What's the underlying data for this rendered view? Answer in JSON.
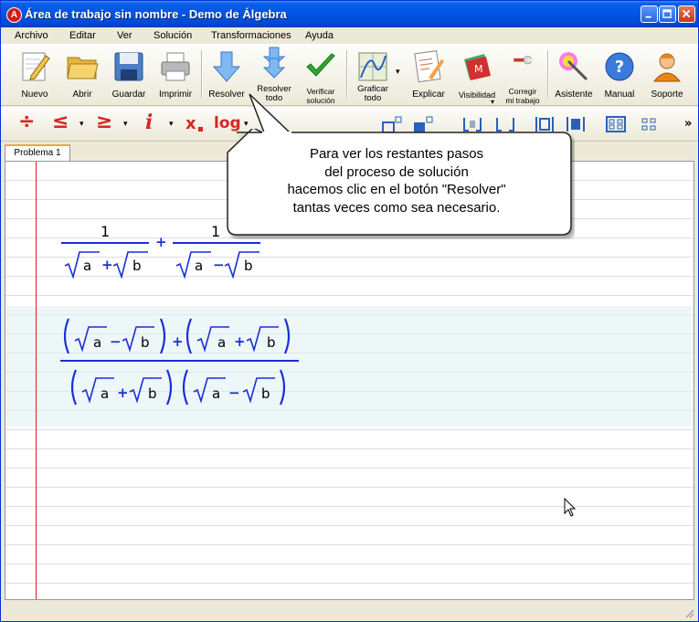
{
  "window": {
    "title": "Área de trabajo sin nombre - Demo de Álgebra",
    "app_icon_letter": "A"
  },
  "menu": [
    "Archivo",
    "Editar",
    "Ver",
    "Solución",
    "Transformaciones",
    "Ayuda"
  ],
  "toolbar": {
    "nuevo": "Nuevo",
    "abrir": "Abrir",
    "guardar": "Guardar",
    "imprimir": "Imprimir",
    "resolver": "Resolver",
    "resolver_todo_1": "Resolver",
    "resolver_todo_2": "todo",
    "verificar_1": "Verificar",
    "verificar_2": "solución",
    "graficar_1": "Graficar",
    "graficar_2": "todo",
    "explicar": "Explicar",
    "visibilidad": "Visibilidad",
    "corregir_1": "Corregir",
    "corregir_2": "mi trabajo",
    "asistente": "Asistente",
    "manual": "Manual",
    "soporte": "Soporte",
    "help_glyph": "?",
    "visibilidad_glyph": "M"
  },
  "math_toolbar": {
    "divide": "÷",
    "le": "≤",
    "ge": "≥",
    "imag": "i",
    "subscript": "x",
    "log": "log",
    "more": "»",
    "dropdown": "▾"
  },
  "tabs": [
    "Problema 1"
  ],
  "callout": {
    "lines": [
      "Para ver los restantes pasos",
      "del proceso de solución",
      "hacemos clic en el botón \"Resolver\"",
      "tantas veces como sea necesario."
    ]
  },
  "expression1": {
    "num1": "1",
    "num2": "1",
    "plus": "+",
    "minus": "−",
    "var_a": "a",
    "var_b": "b"
  },
  "expression2": {
    "plus": "+",
    "minus": "−",
    "var_a": "a",
    "var_b": "b"
  },
  "colors": {
    "title_bar": "#0054e3",
    "math_operator": "#1a2ed8",
    "margin_line": "#d62020",
    "math_toolbar_icons": "#d5271f"
  }
}
